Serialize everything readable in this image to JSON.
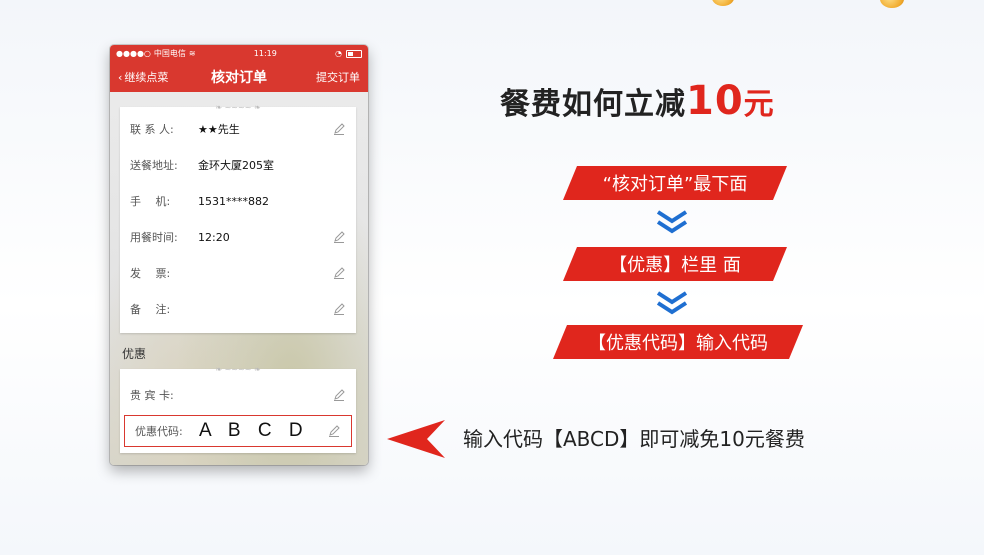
{
  "status_bar": {
    "carrier": "中国电信",
    "time": "11:19"
  },
  "nav": {
    "back_label": "继续点菜",
    "title": "核对订单",
    "submit_label": "提交订单"
  },
  "order_info": {
    "rows": [
      {
        "label": "联 系 人:",
        "value": "★★先生",
        "editable": true
      },
      {
        "label": "送餐地址:",
        "value": "金环大厦205室",
        "editable": false
      },
      {
        "label": "手　 机:",
        "value": "1531****882",
        "editable": false
      },
      {
        "label": "用餐时间:",
        "value": "12:20",
        "editable": true
      },
      {
        "label": "发　 票:",
        "value": "",
        "editable": true
      },
      {
        "label": "备　 注:",
        "value": "",
        "editable": true
      }
    ]
  },
  "discount": {
    "section_label": "优惠",
    "vip_label": "贵 宾 卡:",
    "code_label": "优惠代码:",
    "code_value": "A B C D"
  },
  "promo": {
    "headline_prefix": "餐费如何立减",
    "headline_number": "10",
    "headline_unit": "元",
    "steps": [
      "“核对订单”最下面",
      "【优惠】栏里 面",
      "【优惠代码】输入代码"
    ],
    "instruction": "输入代码【ABCD】即可减免10元餐费"
  },
  "colors": {
    "brand_red": "#d9382f",
    "accent_red": "#e0261d",
    "chevron_blue": "#1f6fd1"
  }
}
